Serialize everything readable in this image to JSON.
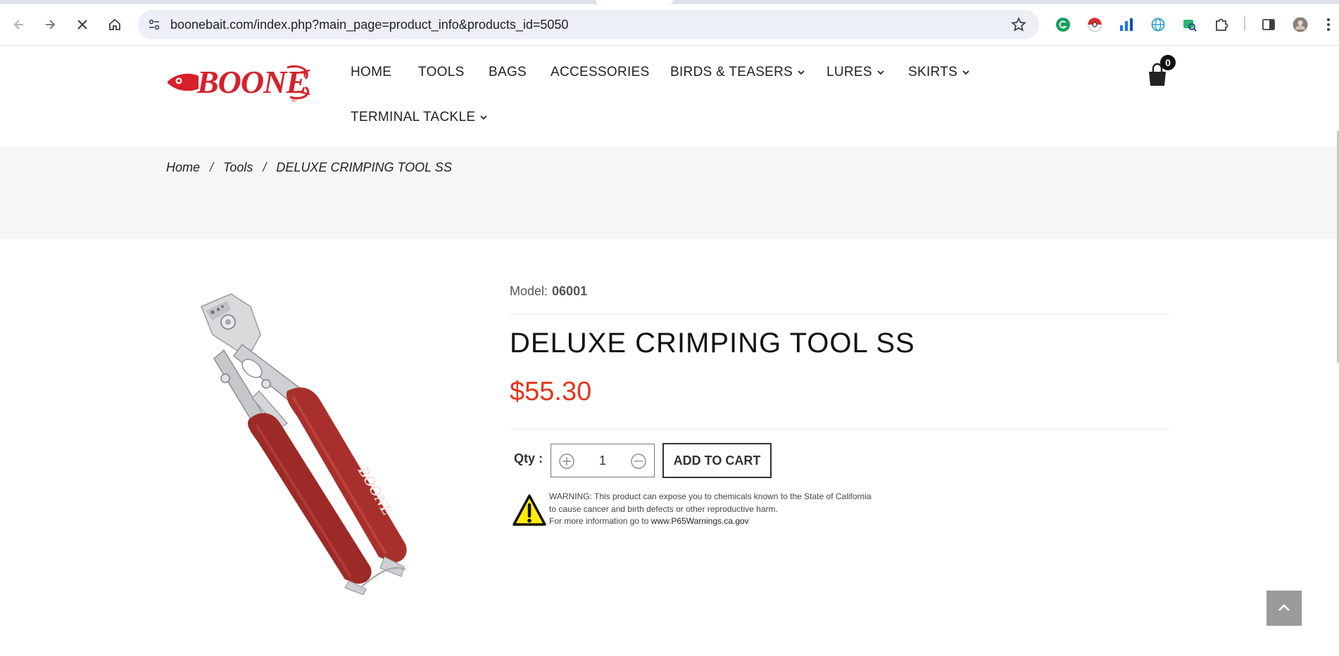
{
  "browser": {
    "url": "boonebait.com/index.php?main_page=product_info&products_id=5050",
    "buttons": {
      "back": "back-arrow-icon",
      "forward": "forward-arrow-icon",
      "stop": "close-icon",
      "home": "home-icon"
    },
    "extensions": [
      "grammarly-icon",
      "pokeball-icon",
      "bar-chart-icon",
      "web-icon",
      "image-search-icon",
      "puzzle-icon",
      "sidebar-icon",
      "avatar",
      "kebab-menu-icon"
    ]
  },
  "header": {
    "logo_text": "BOONE",
    "logo_mark": "®",
    "nav": [
      {
        "label": "HOME",
        "dropdown": false
      },
      {
        "label": "TOOLS",
        "dropdown": false
      },
      {
        "label": "BAGS",
        "dropdown": false
      },
      {
        "label": "ACCESSORIES",
        "dropdown": false
      },
      {
        "label": "BIRDS & TEASERS",
        "dropdown": true
      },
      {
        "label": "LURES",
        "dropdown": true
      },
      {
        "label": "SKIRTS",
        "dropdown": true
      },
      {
        "label": "TERMINAL TACKLE",
        "dropdown": true
      }
    ],
    "cart_count": "0"
  },
  "breadcrumb": {
    "items": [
      "Home",
      "Tools",
      "DELUXE CRIMPING TOOL SS"
    ],
    "separator": "/"
  },
  "product": {
    "model_label": "Model:",
    "model_value": "06001",
    "title": "DELUXE CRIMPING TOOL SS",
    "price": "$55.30",
    "qty_label": "Qty :",
    "qty_value": "1",
    "add_to_cart": "ADD TO CART",
    "warning_lines": [
      "WARNING: This product can expose you to chemicals known to the State of California",
      "to cause cancer and birth defects or other reproductive harm."
    ],
    "warning_more": "For more information go to ",
    "warning_link": "www.P65Warnings.ca.gov",
    "handle_logo_text": "BOONE"
  },
  "colors": {
    "brand_red": "#d6202a",
    "price_red": "#e4361a",
    "handle_red": "#a8302c",
    "warning_yellow": "#ffee00"
  }
}
